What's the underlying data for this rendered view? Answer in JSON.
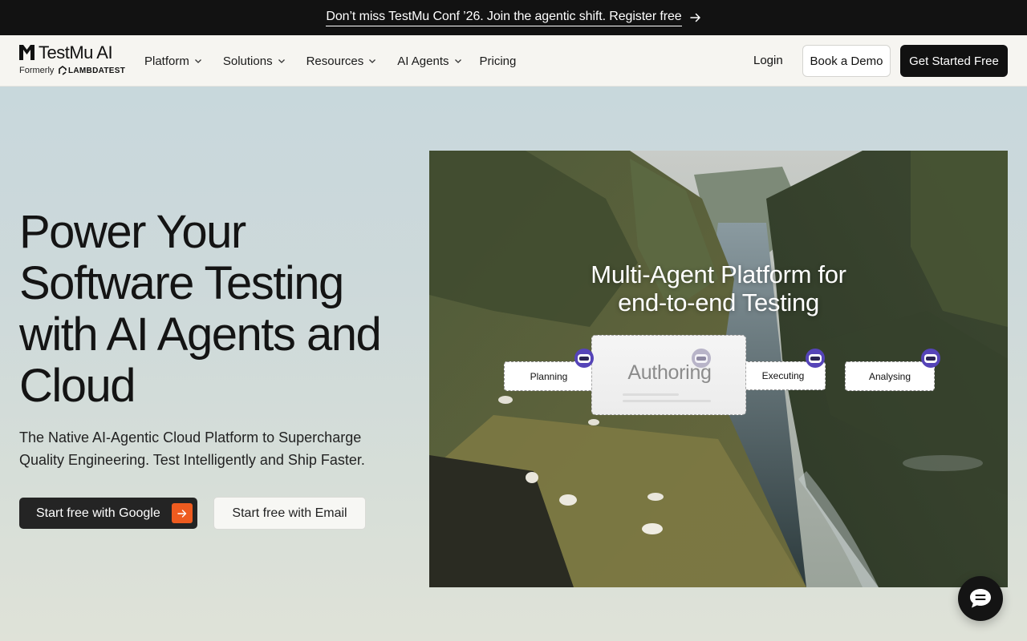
{
  "announcement": {
    "text": "Don’t miss TestMu Conf ’26. Join the agentic shift. Register free",
    "icon": "arrow-right-icon"
  },
  "header": {
    "brand": "TestMu AI",
    "formerly": "Formerly",
    "former_brand": "LAMBDATEST",
    "nav": [
      {
        "label": "Platform",
        "has_dropdown": true
      },
      {
        "label": "Solutions",
        "has_dropdown": true
      },
      {
        "label": "Resources",
        "has_dropdown": true
      },
      {
        "label": "AI Agents",
        "has_dropdown": true
      },
      {
        "label": "Pricing",
        "has_dropdown": false
      }
    ],
    "login": "Login",
    "book_demo": "Book a Demo",
    "get_started": "Get Started Free"
  },
  "hero": {
    "title_lines": [
      "Power Your",
      "Software Testing",
      "with AI Agents and",
      "Cloud"
    ],
    "subtitle": "The Native AI-Agentic Cloud Platform to Supercharge Quality Engineering. Test Intelligently and Ship Faster.",
    "cta_google": "Start free with Google",
    "cta_email": "Start free with Email"
  },
  "visual": {
    "title_line1": "Multi-Agent Platform for",
    "title_line2": "end-to-end Testing",
    "stages": {
      "planning": "Planning",
      "authoring": "Authoring",
      "executing": "Executing",
      "analysing": "Analysing"
    }
  },
  "colors": {
    "announcement_bg": "#121212",
    "header_bg": "#f6f5f1",
    "cta_primary": "#111111",
    "accent_orange": "#ee5b1f",
    "bot_purple": "#6a55c8"
  },
  "chat": {
    "icon": "chat-bubble-icon"
  }
}
